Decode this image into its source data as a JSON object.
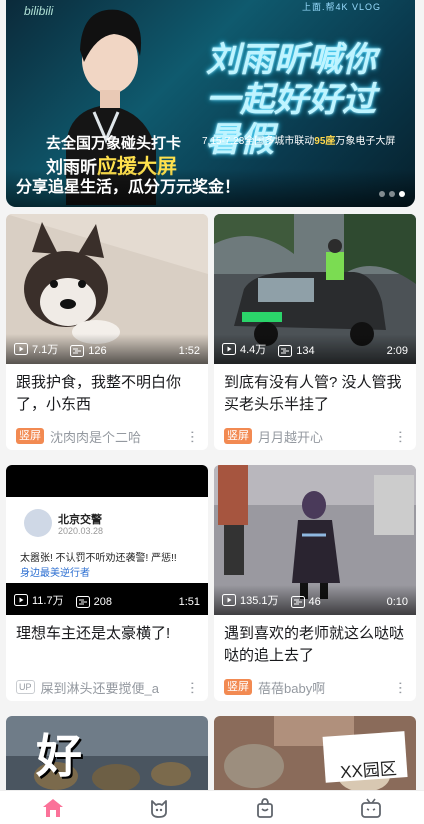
{
  "banner": {
    "logo": "bilibili",
    "top_right": "上面.帮4K VLOG",
    "headline": "刘雨昕喊你一起好好过暑假",
    "dates_prefix": "7.15-7.23全国多城市联动",
    "dates_highlight": "95座",
    "dates_suffix": "万象电子大屏",
    "cta_line1": "去全国万象碰头打卡",
    "cta_line2_name": "刘雨昕",
    "cta_line2_highlight": "应援大屏",
    "caption": "分享追星生活，瓜分万元奖金！",
    "carousel_total": 3,
    "carousel_active": 3
  },
  "feed": [
    {
      "views": "7.1万",
      "danmaku": "126",
      "duration": "1:52",
      "title": "跟我护食，我整不明白你了，小东西",
      "badge": "竖屏",
      "author": "沈肉肉是个二哈",
      "thumb": "husky"
    },
    {
      "views": "4.4万",
      "danmaku": "134",
      "duration": "2:09",
      "title": "到底有没有人管? 没人管我买老头乐半挂了",
      "badge": "竖屏",
      "author": "月月越开心",
      "thumb": "car"
    },
    {
      "views": "11.7万",
      "danmaku": "208",
      "duration": "1:51",
      "title": "理想车主还是太豪横了!",
      "badge": "UP",
      "author": "屎到淋头还要搅便_a",
      "thumb": "weibo",
      "post": {
        "account": "北京交警",
        "date": "2020.03.28",
        "text": "太嚣张! 不认罚不听劝还袭警! 严惩!!",
        "tag": "身边最美逆行者"
      }
    },
    {
      "views": "135.1万",
      "danmaku": "46",
      "duration": "0:10",
      "title": "遇到喜欢的老师就这么哒哒哒的追上去了",
      "badge": "竖屏",
      "author": "蓓蓓baby啊",
      "thumb": "cosplay"
    },
    {
      "thumb": "soldiers",
      "overlay_text": "好 鼠"
    },
    {
      "thumb": "cats",
      "overlay_text": "XX园区"
    }
  ],
  "tabs": [
    {
      "icon": "home-icon",
      "active": true
    },
    {
      "icon": "dynamic-icon",
      "active": false
    },
    {
      "icon": "mall-icon",
      "active": false
    },
    {
      "icon": "tv-icon",
      "active": false
    }
  ],
  "colors": {
    "brand_pink": "#fb7299",
    "badge_orange": "#f28a52",
    "meta_gray": "#9499a0"
  }
}
